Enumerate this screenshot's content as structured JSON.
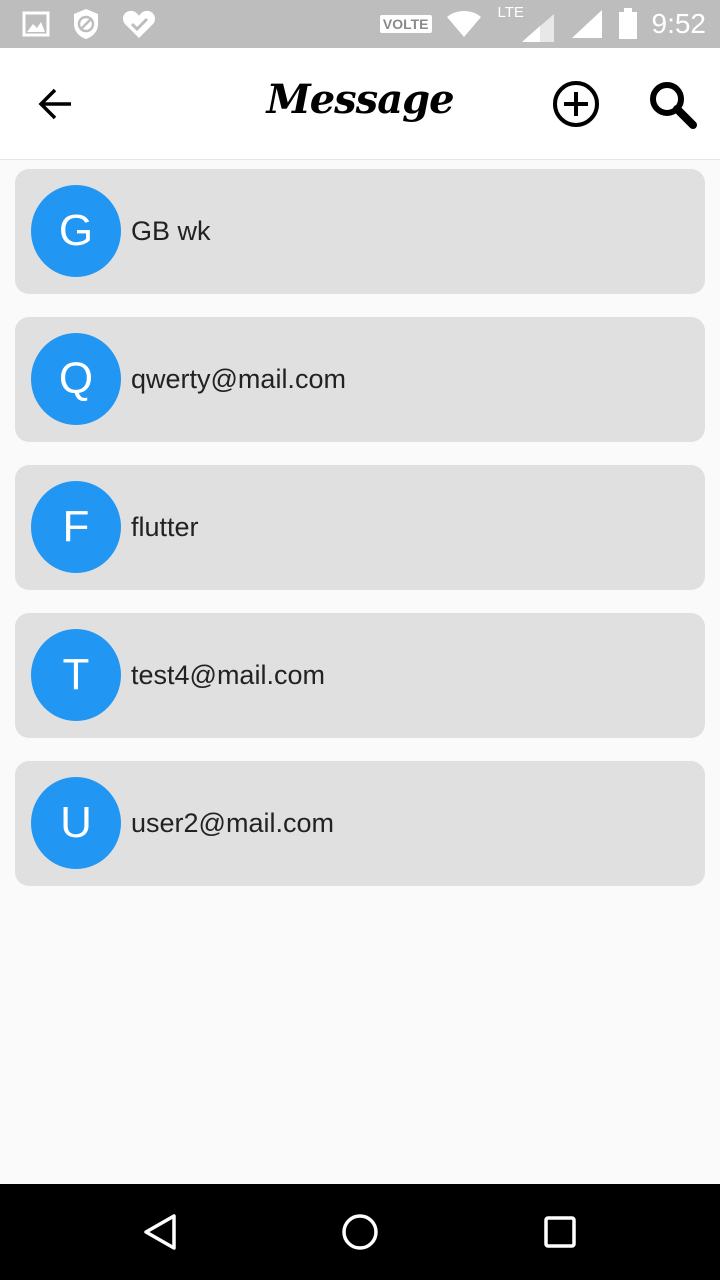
{
  "status_bar": {
    "time": "9:52",
    "network_badge": "VOLTE",
    "network_type": "LTE",
    "icons": [
      "image-icon",
      "shield-block-icon",
      "heart-check-icon",
      "wifi-icon",
      "signal-icon",
      "battery-icon"
    ]
  },
  "app_bar": {
    "title": "Message",
    "back_icon": "arrow-back-icon",
    "add_icon": "add-circle-icon",
    "search_icon": "search-icon"
  },
  "conversations": [
    {
      "initial": "G",
      "name": "GB wk"
    },
    {
      "initial": "Q",
      "name": "qwerty@mail.com"
    },
    {
      "initial": "F",
      "name": "flutter"
    },
    {
      "initial": "T",
      "name": "test4@mail.com"
    },
    {
      "initial": "U",
      "name": "user2@mail.com"
    }
  ],
  "nav_bar": {
    "icons": [
      "back-triangle-icon",
      "home-circle-icon",
      "recents-square-icon"
    ]
  },
  "colors": {
    "avatar": "#2196f3",
    "card": "#e0e0e0",
    "status_bar": "#bdbdbd",
    "background": "#fafafa"
  }
}
